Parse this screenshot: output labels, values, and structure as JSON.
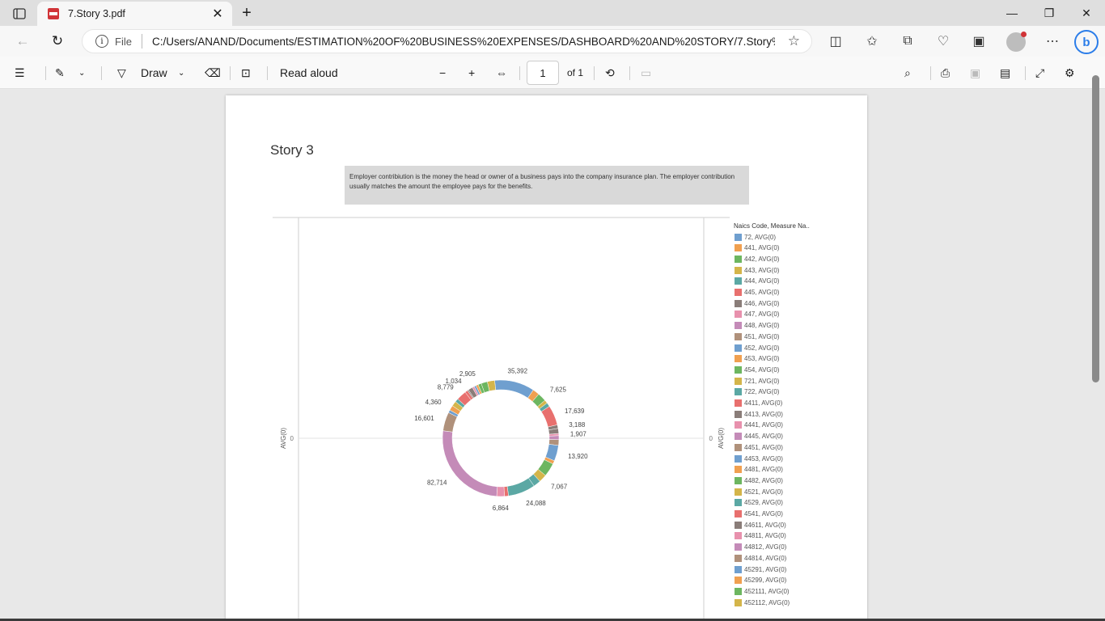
{
  "browser": {
    "tab_title": "7.Story 3.pdf",
    "address_prefix": "File",
    "url": "C:/Users/ANAND/Documents/ESTIMATION%20OF%20BUSINESS%20EXPENSES/DASHBOARD%20AND%20STORY/7.Story%..."
  },
  "pdf_toolbar": {
    "draw_label": "Draw",
    "read_aloud_label": "Read aloud",
    "page_value": "1",
    "page_total": "of 1"
  },
  "page": {
    "title": "Story 3",
    "description": "Employer contribiution is the money the head or owner of a business pays into the company insurance plan. The employer contribution usually matches the amount the employee pays for the benefits."
  },
  "chart_data": {
    "type": "pie",
    "donut": true,
    "axis_label_left": "AVG(0)",
    "axis_label_right": "AVG(0)",
    "axis_tick": "0",
    "legend_title": "Naics Code, Measure Na..",
    "legend_placement": "right",
    "slices": [
      {
        "label": "35,392",
        "value": 35392,
        "color": "#6f9fcf"
      },
      {
        "label": "",
        "value": 6000,
        "color": "#f0a050"
      },
      {
        "label": "7,625",
        "value": 7625,
        "color": "#6db660"
      },
      {
        "label": "",
        "value": 3000,
        "color": "#d4b54a"
      },
      {
        "label": "",
        "value": 3500,
        "color": "#5ba8a4"
      },
      {
        "label": "17,639",
        "value": 17639,
        "color": "#e8706e"
      },
      {
        "label": "3,188",
        "value": 3188,
        "color": "#8a7d79"
      },
      {
        "label": "",
        "value": 4500,
        "color": "#8a7d79"
      },
      {
        "label": "1,907",
        "value": 1907,
        "color": "#e891ad"
      },
      {
        "label": "",
        "value": 3500,
        "color": "#c48bb8"
      },
      {
        "label": "",
        "value": 5000,
        "color": "#b0917b"
      },
      {
        "label": "13,920",
        "value": 13920,
        "color": "#6f9fcf"
      },
      {
        "label": "",
        "value": 3000,
        "color": "#f0a050"
      },
      {
        "label": "",
        "value": 12000,
        "color": "#6db660"
      },
      {
        "label": "7,067",
        "value": 7067,
        "color": "#d4b54a"
      },
      {
        "label": "",
        "value": 6500,
        "color": "#5ba8a4"
      },
      {
        "label": "24,088",
        "value": 24088,
        "color": "#5ba8a4"
      },
      {
        "label": "",
        "value": 3500,
        "color": "#e8706e"
      },
      {
        "label": "6,864",
        "value": 6864,
        "color": "#e891ad"
      },
      {
        "label": "82,714",
        "value": 82714,
        "color": "#c48bb8"
      },
      {
        "label": "16,601",
        "value": 16601,
        "color": "#b0917b"
      },
      {
        "label": "",
        "value": 2500,
        "color": "#6f9fcf"
      },
      {
        "label": "4,360",
        "value": 4360,
        "color": "#f0a050"
      },
      {
        "label": "",
        "value": 4500,
        "color": "#d4b54a"
      },
      {
        "label": "",
        "value": 3000,
        "color": "#5ba8a4"
      },
      {
        "label": "8,779",
        "value": 8779,
        "color": "#e8706e"
      },
      {
        "label": "",
        "value": 2500,
        "color": "#e8706e"
      },
      {
        "label": "1,034",
        "value": 1034,
        "color": "#8a7d79"
      },
      {
        "label": "",
        "value": 4000,
        "color": "#8a7d79"
      },
      {
        "label": "",
        "value": 1800,
        "color": "#e891ad"
      },
      {
        "label": "",
        "value": 1800,
        "color": "#6f9fcf"
      },
      {
        "label": "",
        "value": 2000,
        "color": "#f0a050"
      },
      {
        "label": "2,905",
        "value": 2905,
        "color": "#6db660"
      },
      {
        "label": "",
        "value": 5500,
        "color": "#6db660"
      },
      {
        "label": "",
        "value": 6500,
        "color": "#d4b54a"
      }
    ],
    "legend": [
      {
        "label": "72, AVG(0)",
        "color": "#6f9fcf"
      },
      {
        "label": "441, AVG(0)",
        "color": "#f0a050"
      },
      {
        "label": "442, AVG(0)",
        "color": "#6db660"
      },
      {
        "label": "443, AVG(0)",
        "color": "#d4b54a"
      },
      {
        "label": "444, AVG(0)",
        "color": "#5ba8a4"
      },
      {
        "label": "445, AVG(0)",
        "color": "#e8706e"
      },
      {
        "label": "446, AVG(0)",
        "color": "#8a7d79"
      },
      {
        "label": "447, AVG(0)",
        "color": "#e891ad"
      },
      {
        "label": "448, AVG(0)",
        "color": "#c48bb8"
      },
      {
        "label": "451, AVG(0)",
        "color": "#b0917b"
      },
      {
        "label": "452, AVG(0)",
        "color": "#6f9fcf"
      },
      {
        "label": "453, AVG(0)",
        "color": "#f0a050"
      },
      {
        "label": "454, AVG(0)",
        "color": "#6db660"
      },
      {
        "label": "721, AVG(0)",
        "color": "#d4b54a"
      },
      {
        "label": "722, AVG(0)",
        "color": "#5ba8a4"
      },
      {
        "label": "4411, AVG(0)",
        "color": "#e8706e"
      },
      {
        "label": "4413, AVG(0)",
        "color": "#8a7d79"
      },
      {
        "label": "4441, AVG(0)",
        "color": "#e891ad"
      },
      {
        "label": "4445, AVG(0)",
        "color": "#c48bb8"
      },
      {
        "label": "4451, AVG(0)",
        "color": "#b0917b"
      },
      {
        "label": "4453, AVG(0)",
        "color": "#6f9fcf"
      },
      {
        "label": "4481, AVG(0)",
        "color": "#f0a050"
      },
      {
        "label": "4482, AVG(0)",
        "color": "#6db660"
      },
      {
        "label": "4521, AVG(0)",
        "color": "#d4b54a"
      },
      {
        "label": "4529, AVG(0)",
        "color": "#5ba8a4"
      },
      {
        "label": "4541, AVG(0)",
        "color": "#e8706e"
      },
      {
        "label": "44611, AVG(0)",
        "color": "#8a7d79"
      },
      {
        "label": "44811, AVG(0)",
        "color": "#e891ad"
      },
      {
        "label": "44812, AVG(0)",
        "color": "#c48bb8"
      },
      {
        "label": "44814, AVG(0)",
        "color": "#b0917b"
      },
      {
        "label": "45291, AVG(0)",
        "color": "#6f9fcf"
      },
      {
        "label": "45299, AVG(0)",
        "color": "#f0a050"
      },
      {
        "label": "452111, AVG(0)",
        "color": "#6db660"
      },
      {
        "label": "452112, AVG(0)",
        "color": "#d4b54a"
      }
    ]
  }
}
